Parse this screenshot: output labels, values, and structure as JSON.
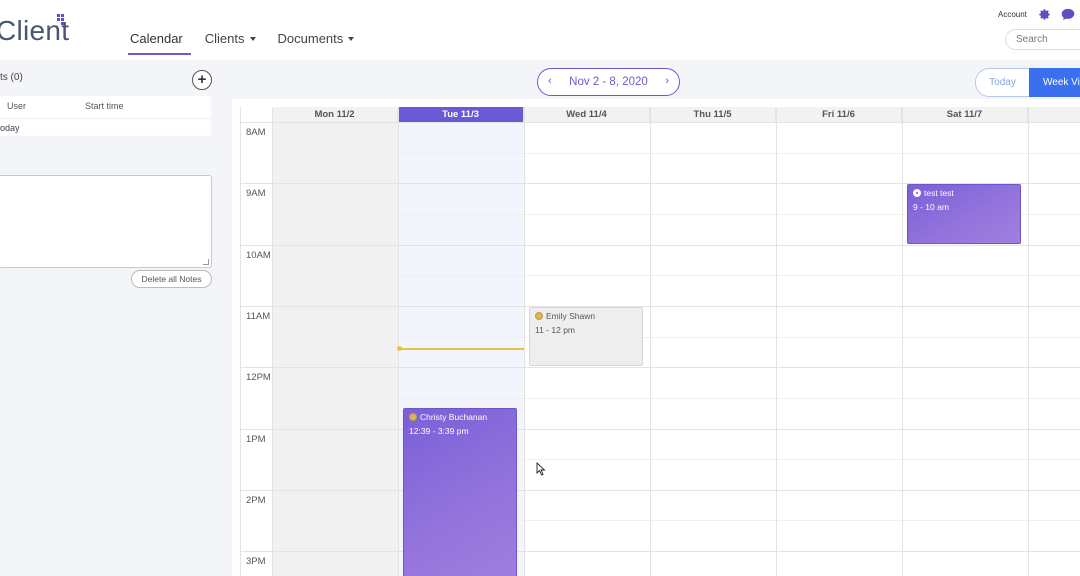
{
  "app": {
    "logo_text": "Client"
  },
  "nav": {
    "items": [
      {
        "label": "Calendar",
        "active": true,
        "dropdown": false
      },
      {
        "label": "Clients",
        "active": false,
        "dropdown": true
      },
      {
        "label": "Documents",
        "active": false,
        "dropdown": true
      }
    ]
  },
  "header": {
    "account_label": "Account",
    "search_placeholder": "Search",
    "icons": [
      "gear-icon",
      "chat-icon"
    ]
  },
  "left_panel": {
    "title": "ts (0)",
    "add_icon": "plus-icon",
    "table": {
      "columns": [
        "User",
        "Start time"
      ],
      "rows": [
        [
          "oday",
          ""
        ]
      ]
    },
    "notes_value": "",
    "delete_notes_label": "Delete all Notes"
  },
  "date_nav": {
    "range": "Nov 2 - 8, 2020",
    "prev_icon": "chevron-left-icon",
    "next_icon": "chevron-right-icon"
  },
  "view_toggle": {
    "today_label": "Today",
    "week_label": "Week Vi"
  },
  "calendar": {
    "days": [
      "Mon 11/2",
      "Tue 11/3",
      "Wed 11/4",
      "Thu 11/5",
      "Fri 11/6",
      "Sat 11/7",
      "Su"
    ],
    "today_index": 1,
    "hours": [
      "8AM",
      "9AM",
      "10AM",
      "11AM",
      "12PM",
      "1PM",
      "2PM",
      "3PM"
    ],
    "events": [
      {
        "title": "test test",
        "time": "9 - 10 am",
        "day": 5,
        "start": 9,
        "end": 10,
        "style": "purple",
        "icon": "person-icon"
      },
      {
        "title": "Emily Shawn",
        "time": "11 - 12 pm",
        "day": 2,
        "start": 11,
        "end": 12,
        "style": "grey",
        "icon": "sun-icon"
      },
      {
        "title": "Christy Buchanan",
        "time": "12:39 - 3:39 pm",
        "day": 1,
        "start": 12.65,
        "end": 15.65,
        "style": "purple",
        "icon": "sun-icon"
      }
    ],
    "current_time_hour": 11.7,
    "colors": {
      "accent": "#6a5acd",
      "today_header": "#6a5ad6",
      "event_purple": "#8a6bdb",
      "now_line": "#e8c24a",
      "week_button": "#3a6ff0"
    }
  }
}
